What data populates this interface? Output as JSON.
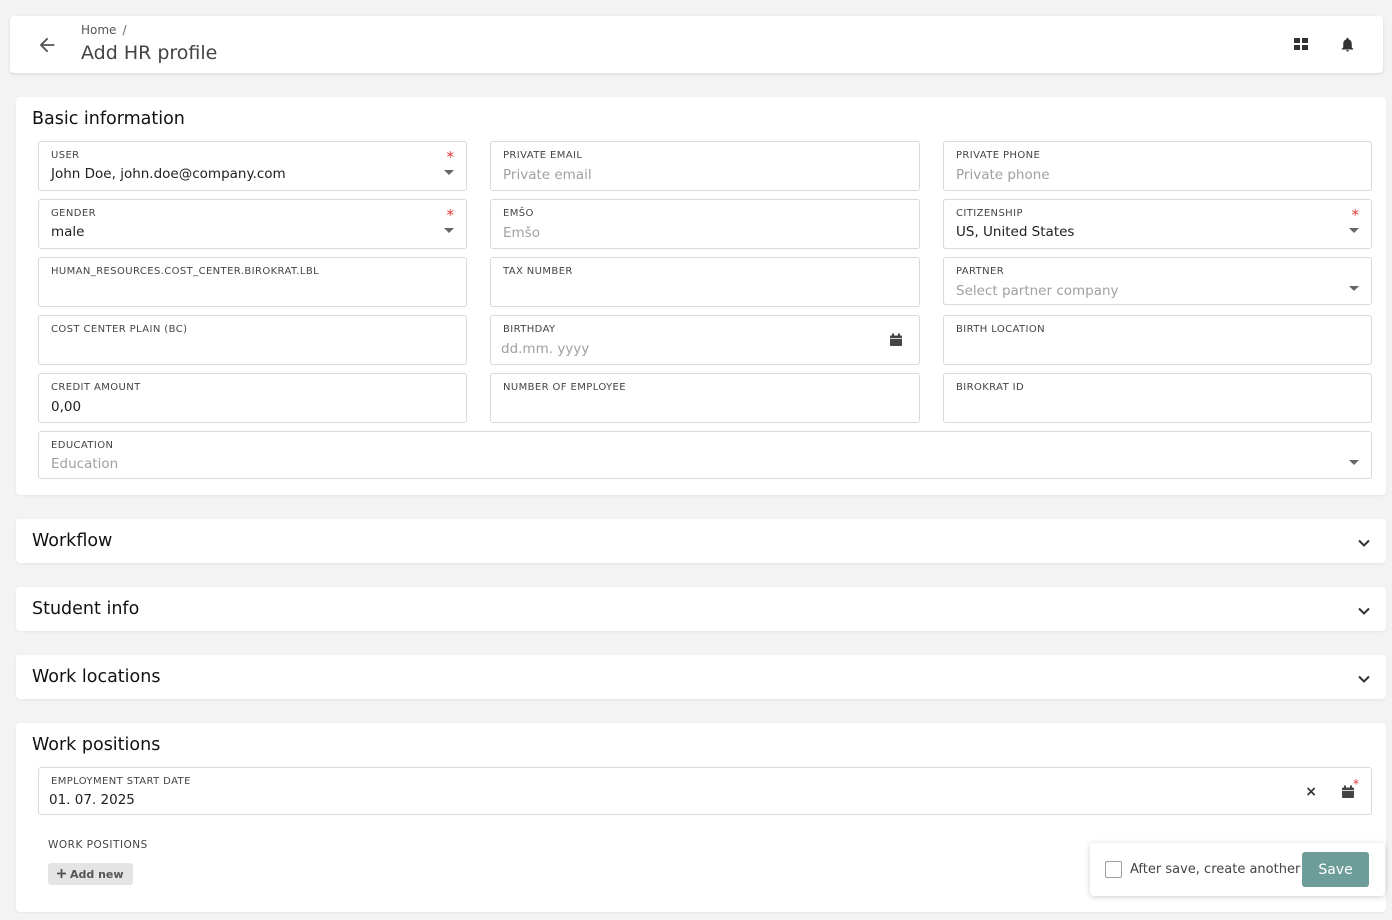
{
  "header": {
    "breadcrumb": "Home",
    "breadcrumb_sep": "/",
    "title": "Add HR profile",
    "icons": [
      "back-arrow-icon",
      "dashboard-grid-icon",
      "bell-icon"
    ]
  },
  "basic": {
    "title": "Basic information",
    "user": {
      "label": "USER",
      "value": "John Doe, john.doe@company.com",
      "required": "*"
    },
    "private_email": {
      "label": "PRIVATE EMAIL",
      "placeholder": "Private email"
    },
    "private_phone": {
      "label": "PRIVATE PHONE",
      "placeholder": "Private phone"
    },
    "gender": {
      "label": "GENDER",
      "value": "male",
      "required": "*"
    },
    "emso": {
      "label": "EMŠO",
      "placeholder": "Emšo"
    },
    "citizenship": {
      "label": "CITIZENSHIP",
      "value": "US, United States",
      "required": "*"
    },
    "cost_center": {
      "label": "HUMAN_RESOURCES.COST_CENTER.BIROKRAT.LBL",
      "value": ""
    },
    "tax_number": {
      "label": "TAX NUMBER",
      "value": ""
    },
    "partner": {
      "label": "PARTNER",
      "placeholder": "Select partner company"
    },
    "cost_center_plain": {
      "label": "COST CENTER PLAIN (BC)",
      "value": ""
    },
    "birthday": {
      "label": "BIRTHDAY",
      "placeholder": "dd.mm. yyyy"
    },
    "birth_location": {
      "label": "BIRTH LOCATION",
      "value": ""
    },
    "credit_amount": {
      "label": "CREDIT AMOUNT",
      "value": "0,00"
    },
    "number_of_employee": {
      "label": "NUMBER OF EMPLOYEE",
      "value": ""
    },
    "birokrat_id": {
      "label": "BIROKRAT ID",
      "value": ""
    },
    "education": {
      "label": "EDUCATION",
      "placeholder": "Education"
    }
  },
  "sections": {
    "workflow": "Workflow",
    "student_info": "Student info",
    "work_locations": "Work locations"
  },
  "work_positions": {
    "title": "Work positions",
    "start_date": {
      "label": "EMPLOYMENT START DATE",
      "value": "01. 07. 2025",
      "required": "*"
    },
    "list_label": "WORK POSITIONS",
    "add_new": "Add new"
  },
  "footer": {
    "checkbox_label": "After save, create another",
    "checkbox_checked": false,
    "save_label": "Save",
    "save_color": "#6d9d98"
  }
}
